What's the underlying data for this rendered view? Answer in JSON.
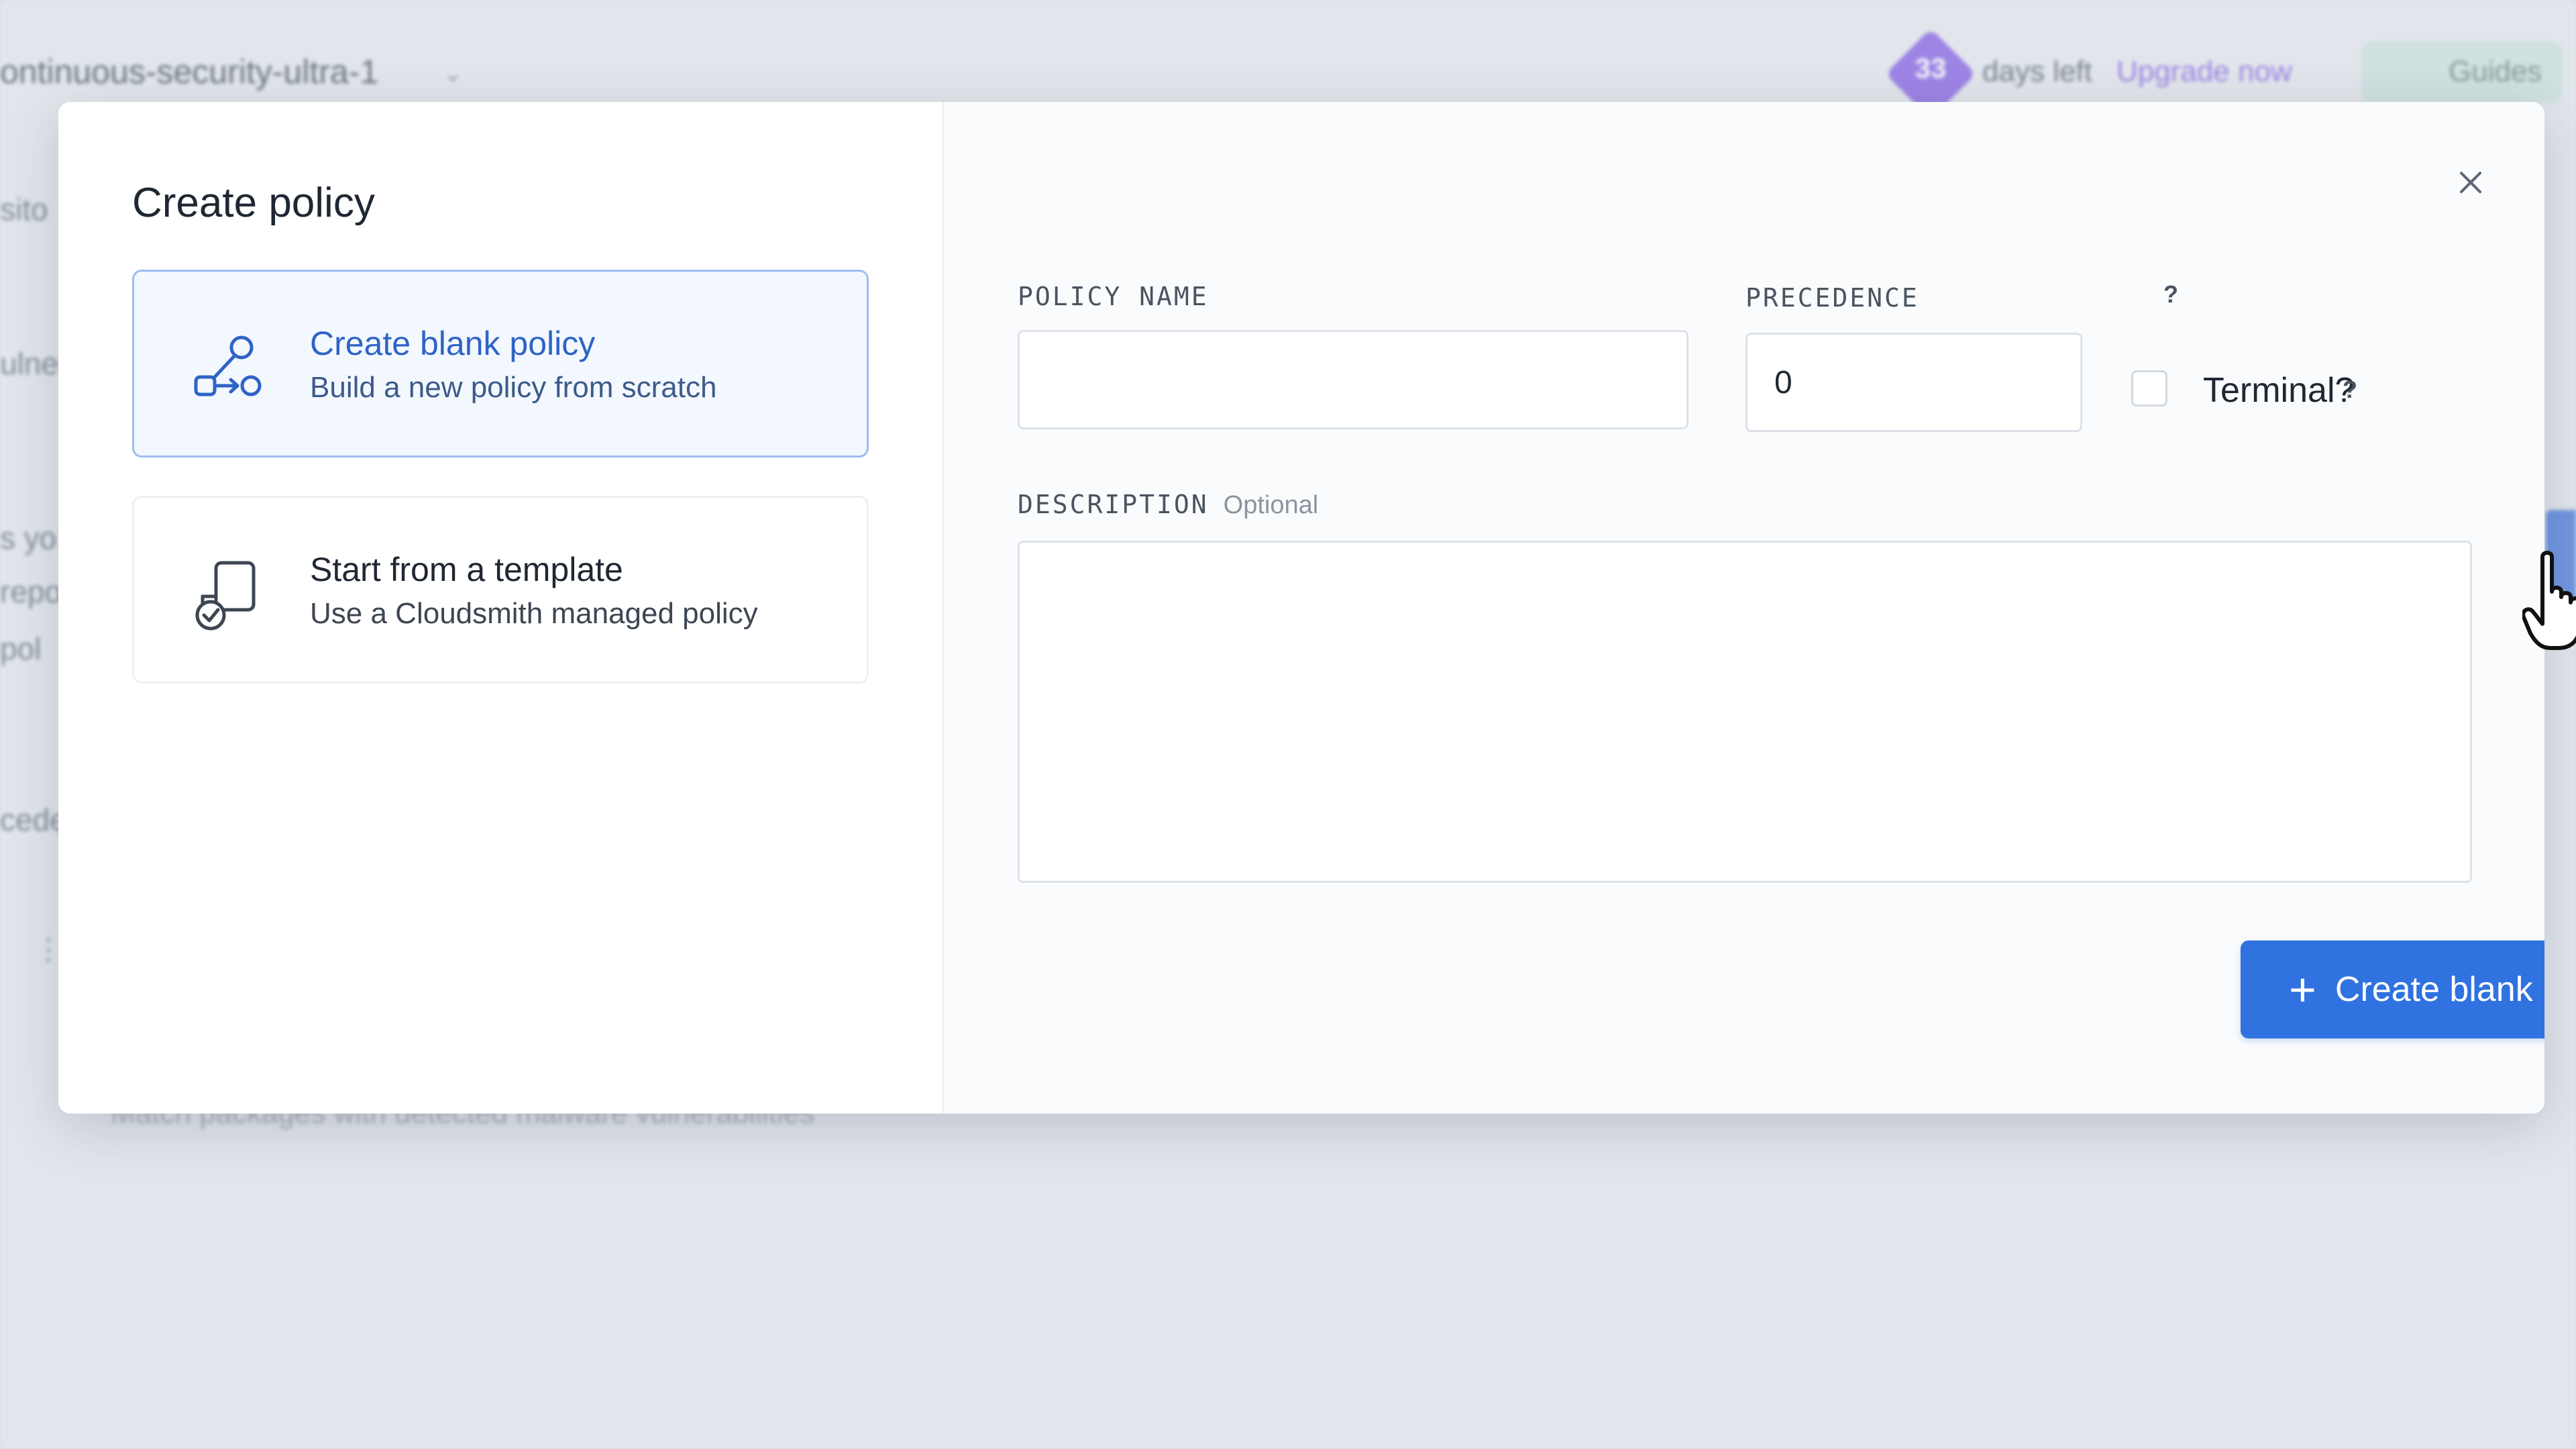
{
  "background": {
    "workspace_name": "ontinuous-security-ultra-1",
    "trial_days": "33",
    "days_left_label": "days left",
    "upgrade_label": "Upgrade now",
    "guides_label": "Guides",
    "fragments": [
      "sito",
      "ulner",
      "s yo",
      "repo",
      "pol",
      "cede"
    ],
    "footer_text": "Match packages with detected malware vulnerabilities"
  },
  "modal": {
    "title": "Create policy",
    "options": [
      {
        "title": "Create blank policy",
        "subtitle": "Build a new policy from scratch",
        "icon": "flow-icon",
        "selected": true
      },
      {
        "title": "Start from a template",
        "subtitle": "Use a Cloudsmith managed policy",
        "icon": "template-check-icon",
        "selected": false
      }
    ],
    "form": {
      "policy_name_label": "POLICY NAME",
      "policy_name_value": "",
      "precedence_label": "PRECEDENCE",
      "precedence_help": "?",
      "precedence_value": "0",
      "terminal_label": "Terminal?",
      "terminal_help": "?",
      "terminal_checked": false,
      "description_label": "DESCRIPTION",
      "description_optional": "Optional",
      "description_value": "",
      "submit_label": "Create blank policy"
    }
  },
  "colors": {
    "accent": "#2f72e0",
    "selected_border": "#9dbcf0",
    "selected_bg": "#f3f8ff",
    "trial_badge": "#8b67e6"
  }
}
